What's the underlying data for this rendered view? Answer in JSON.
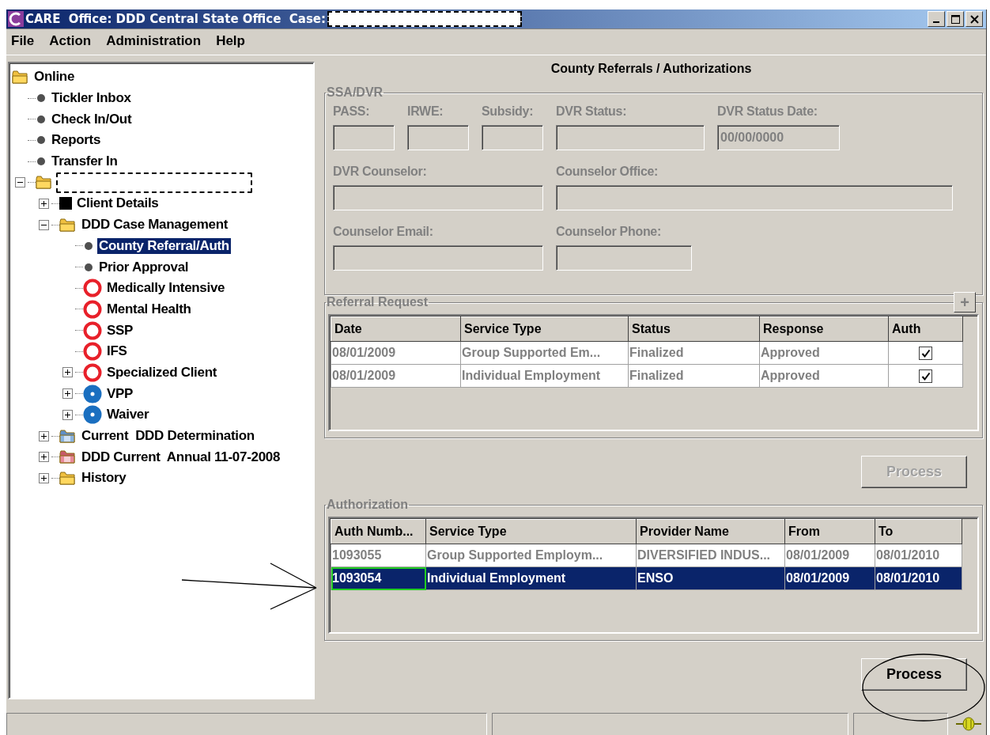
{
  "window": {
    "title": "CARE  Office: DDD Central State Office  Case:",
    "title_redacted": true
  },
  "menu": [
    {
      "label": "File"
    },
    {
      "label": "Action"
    },
    {
      "label": "Administration"
    },
    {
      "label": "Help"
    }
  ],
  "tree": [
    {
      "label": "Online",
      "kind": "folder",
      "selected": false,
      "children": [
        {
          "label": "Tickler Inbox",
          "kind": "bullet",
          "selected": false
        },
        {
          "label": "Check In/Out",
          "kind": "bullet",
          "selected": false
        },
        {
          "label": "Reports",
          "kind": "bullet",
          "selected": false
        },
        {
          "label": "Transfer In",
          "kind": "bullet",
          "selected": false
        },
        {
          "kind": "folder",
          "redacted": true,
          "expanded": true,
          "selected": false,
          "children": [
            {
              "label": "Client Details",
              "kind": "square",
              "expanded": false,
              "selected": false
            },
            {
              "label": "DDD Case Management",
              "kind": "folder",
              "expanded": true,
              "selected": false,
              "children": [
                {
                  "label": "County Referral/Auth",
                  "kind": "bullet",
                  "selected": true
                },
                {
                  "label": "Prior Approval",
                  "kind": "bullet",
                  "selected": false
                },
                {
                  "label": "Medically Intensive",
                  "kind": "ring",
                  "selected": false
                },
                {
                  "label": "Mental Health",
                  "kind": "ring",
                  "selected": false
                },
                {
                  "label": "SSP",
                  "kind": "ring",
                  "selected": false
                },
                {
                  "label": "IFS",
                  "kind": "ring",
                  "selected": false
                },
                {
                  "label": "Specialized Client",
                  "kind": "ring",
                  "expanded": false,
                  "selected": false
                },
                {
                  "label": "VPP",
                  "kind": "disc",
                  "expanded": false,
                  "selected": false
                },
                {
                  "label": "Waiver",
                  "kind": "disc",
                  "expanded": false,
                  "selected": false
                }
              ]
            },
            {
              "label": "Current  DDD Determination",
              "kind": "folder_d",
              "expanded": false,
              "selected": false
            },
            {
              "label": "DDD Current  Annual 11-07-2008",
              "kind": "folder_a",
              "expanded": false,
              "selected": false
            },
            {
              "label": "History",
              "kind": "folder",
              "expanded": false,
              "selected": false
            }
          ]
        }
      ]
    }
  ],
  "panel": {
    "title": "County Referrals / Authorizations",
    "ssa_dvr": {
      "legend": "SSA/DVR",
      "disabled": true,
      "rows": [
        [
          {
            "label": "PASS:"
          },
          {
            "label": "IRWE:"
          },
          {
            "label": "Subsidy:"
          },
          {
            "label": "DVR Status:"
          },
          {
            "label": "DVR Status Date:",
            "value": "00/00/0000"
          }
        ],
        [
          {
            "label": "DVR Counselor:"
          },
          {
            "label": "Counselor Office:"
          }
        ],
        [
          {
            "label": "Counselor Email:"
          },
          {
            "label": "Counselor Phone:"
          }
        ]
      ]
    },
    "referral": {
      "legend": "Referral Request",
      "add_button": "+",
      "columns": [
        "Date",
        "Service Type",
        "Status",
        "Response",
        "Auth"
      ],
      "rows": [
        {
          "cells": [
            "08/01/2009",
            "Group Supported Em...",
            "Finalized",
            "Approved"
          ],
          "auth": true,
          "selected": false
        },
        {
          "cells": [
            "08/01/2009",
            "Individual Employment",
            "Finalized",
            "Approved"
          ],
          "auth": true,
          "selected": false
        }
      ],
      "button": {
        "label": "Process",
        "disabled": true
      }
    },
    "authorization": {
      "legend": "Authorization",
      "columns": [
        "Auth Numb...",
        "Service Type",
        "Provider Name",
        "From",
        "To"
      ],
      "rows": [
        {
          "cells": [
            "1093055",
            "Group Supported Employm...",
            "DIVERSIFIED INDUS...",
            "08/01/2009",
            "08/01/2010"
          ],
          "selected": false
        },
        {
          "cells": [
            "1093054",
            "Individual Employment",
            "ENSO",
            "08/01/2009",
            "08/01/2010"
          ],
          "selected": true
        }
      ],
      "button": {
        "label": "Process",
        "disabled": false
      }
    }
  }
}
